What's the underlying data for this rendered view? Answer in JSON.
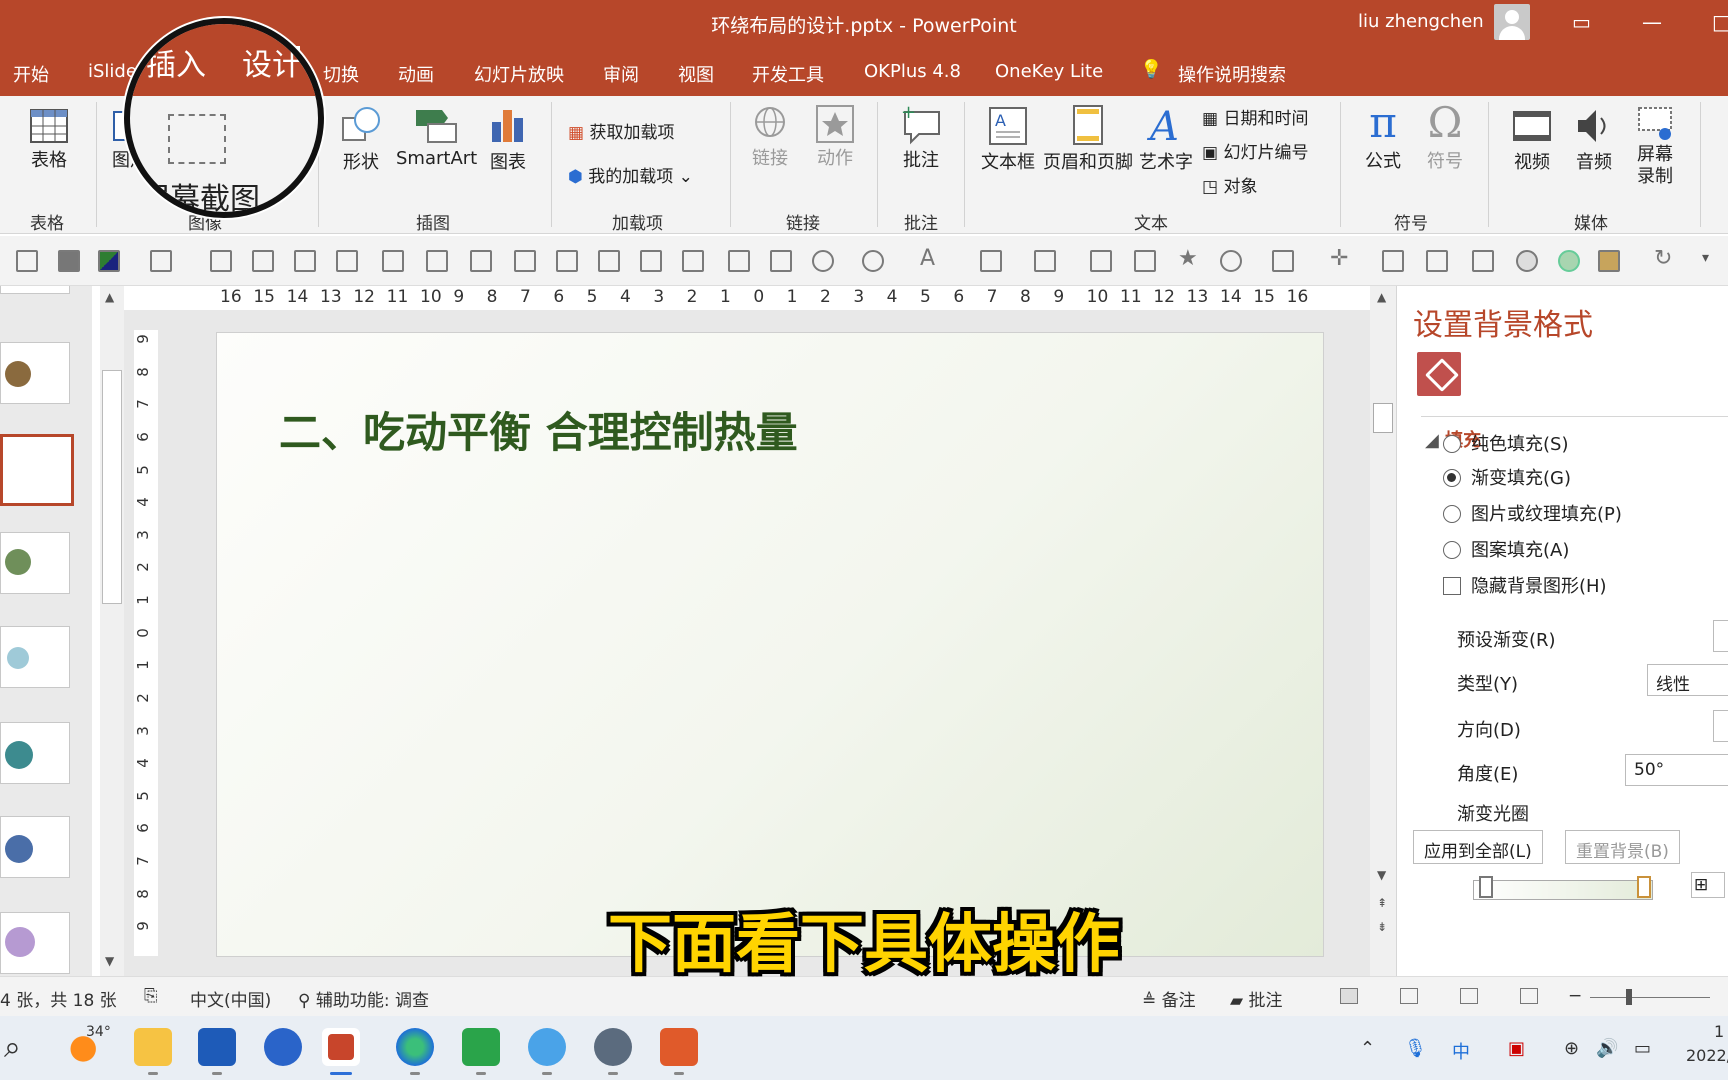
{
  "titlebar": {
    "title": "环绕布局的设计.pptx  -  PowerPoint",
    "user": "liu zhengchen",
    "window_buttons": [
      "ribbon-display-icon",
      "minimize-icon",
      "restore-icon"
    ]
  },
  "tabs": [
    {
      "label": "开始"
    },
    {
      "label": "iSlide"
    },
    {
      "label": "插入",
      "active": true
    },
    {
      "label": "设计"
    },
    {
      "label": "切换"
    },
    {
      "label": "动画"
    },
    {
      "label": "幻灯片放映"
    },
    {
      "label": "审阅"
    },
    {
      "label": "视图"
    },
    {
      "label": "开发工具"
    },
    {
      "label": "OKPlus 4.8"
    },
    {
      "label": "OneKey Lite"
    },
    {
      "label": "操作说明搜索"
    }
  ],
  "ribbon": {
    "table": {
      "btn": "表格",
      "group": "表格"
    },
    "images": {
      "btn": "图片",
      "group": "图像",
      "screenshot": "屏幕截图"
    },
    "illustrations": {
      "shapes": "形状",
      "smartart": "SmartArt",
      "chart": "图表",
      "group": "插图"
    },
    "addins": {
      "get": "获取加载项",
      "mine": "我的加载项",
      "group": "加载项"
    },
    "links": {
      "link": "链接",
      "action": "动作",
      "group": "链接"
    },
    "comments": {
      "comment": "批注",
      "group": "批注"
    },
    "text": {
      "textbox": "文本框",
      "headerfooter": "页眉和页脚",
      "wordart": "艺术字",
      "datetime": "日期和时间",
      "slidenum": "幻灯片编号",
      "object": "对象",
      "group": "文本"
    },
    "symbols": {
      "equation": "公式",
      "symbol": "符号",
      "group": "符号"
    },
    "media": {
      "video": "视频",
      "audio": "音频",
      "screenrec": "屏幕录制",
      "group": "媒体"
    }
  },
  "ruler": {
    "h_ticks": [
      "16",
      "15",
      "14",
      "13",
      "12",
      "11",
      "10",
      "9",
      "8",
      "7",
      "6",
      "5",
      "4",
      "3",
      "2",
      "1",
      "0",
      "1",
      "2",
      "3",
      "4",
      "5",
      "6",
      "7",
      "8",
      "9",
      "10",
      "11",
      "12",
      "13",
      "14",
      "15",
      "16"
    ],
    "v_ticks": [
      "9",
      "8",
      "7",
      "6",
      "5",
      "4",
      "3",
      "2",
      "1",
      "0",
      "1",
      "2",
      "3",
      "4",
      "5",
      "6",
      "7",
      "8",
      "9"
    ]
  },
  "slide": {
    "title": "二、吃动平衡 合理控制热量"
  },
  "pane": {
    "title": "设置背景格式",
    "section": "填充",
    "options": [
      {
        "label": "纯色填充(S)",
        "checked": false
      },
      {
        "label": "渐变填充(G)",
        "checked": true
      },
      {
        "label": "图片或纹理填充(P)",
        "checked": false
      },
      {
        "label": "图案填充(A)",
        "checked": false
      }
    ],
    "hide_bg": "隐藏背景图形(H)",
    "preset": "预设渐变(R)",
    "type_label": "类型(Y)",
    "type_value": "线性",
    "direction": "方向(D)",
    "angle_label": "角度(E)",
    "angle_value": "50°",
    "stops": "渐变光圈",
    "apply_all": "应用到全部(L)",
    "reset": "重置背景(B)"
  },
  "status": {
    "slide_count": "4 张，共 18 张",
    "language": "中文(中国)",
    "accessibility": "辅助功能: 调查",
    "notes": "备注",
    "comments": "批注"
  },
  "subtitle": "下面看下具体操作",
  "taskbar": {
    "weather": "34°",
    "time": "1",
    "date": "2022/"
  },
  "colors": {
    "accent": "#b7472a",
    "title_green": "#2f5a1f",
    "subtitle_yellow": "#ffd400"
  }
}
